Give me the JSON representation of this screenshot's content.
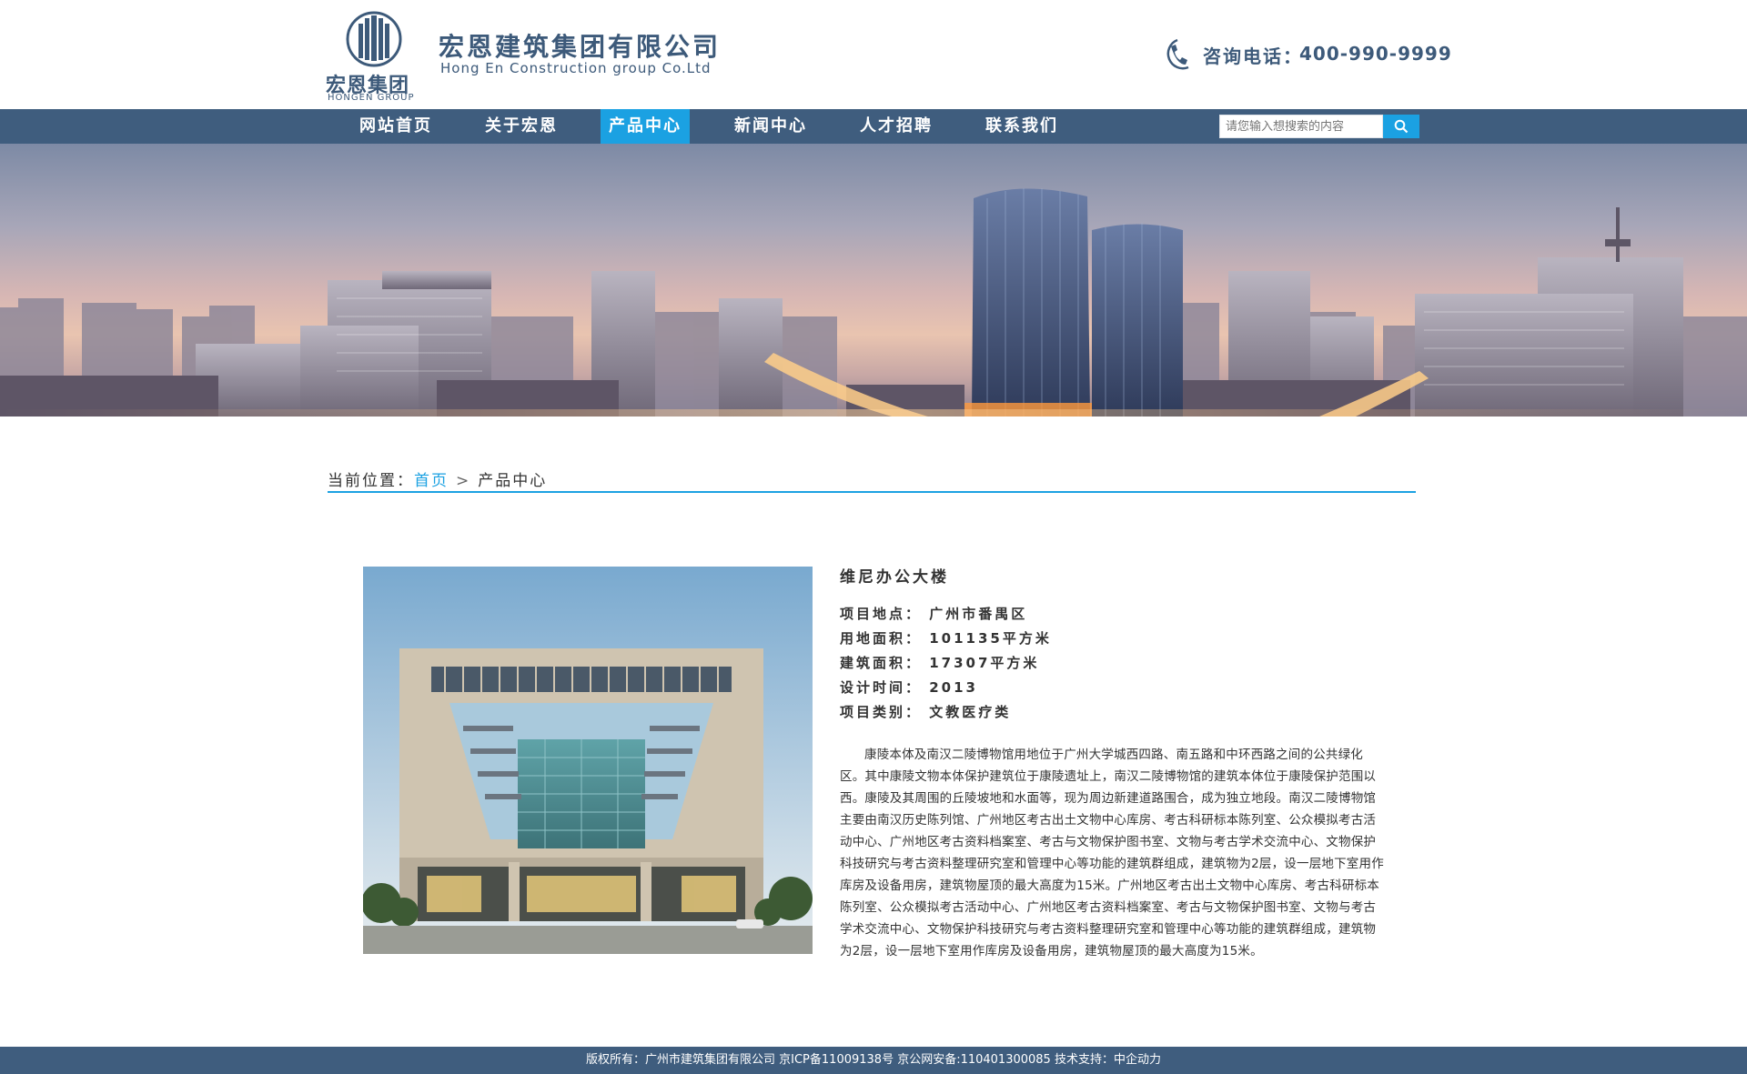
{
  "header": {
    "logo_cn": "宏恩集团",
    "logo_en": "HONGEN GROUP",
    "company_cn": "宏恩建筑集团有限公司",
    "company_en": "Hong En Construction group Co.Ltd",
    "phone_label": "咨询电话：",
    "phone_number": "400-990-9999",
    "brand_color": "#3d5a7a"
  },
  "nav": {
    "items": [
      {
        "label": "网站首页"
      },
      {
        "label": "关于宏恩"
      },
      {
        "label": "产品中心",
        "active": true
      },
      {
        "label": "新闻中心"
      },
      {
        "label": "人才招聘"
      },
      {
        "label": "联系我们"
      }
    ],
    "search_placeholder": "请您输入想搜索的内容",
    "search_icon": "search-icon",
    "nav_color": "#3f5d7e",
    "accent_color": "#1ba1e2"
  },
  "breadcrumb": {
    "prefix": "当前位置：",
    "home": "首页",
    "separator": ">",
    "current": "产品中心"
  },
  "product": {
    "title": "维尼办公大楼",
    "attributes": [
      {
        "text": "项目地点： 广州市番禺区"
      },
      {
        "text": "用地面积： 101135平方米"
      },
      {
        "text": "建筑面积： 17307平方米"
      },
      {
        "text": "设计时间： 2013"
      },
      {
        "text": "项目类别： 文教医疗类"
      }
    ],
    "description": "康陵本体及南汉二陵博物馆用地位于广州大学城西四路、南五路和中环西路之间的公共绿化区。其中康陵文物本体保护建筑位于康陵遗址上，南汉二陵博物馆的建筑本体位于康陵保护范围以西。康陵及其周围的丘陵坡地和水面等，现为周边新建道路围合，成为独立地段。南汉二陵博物馆主要由南汉历史陈列馆、广州地区考古出土文物中心库房、考古科研标本陈列室、公众模拟考古活动中心、广州地区考古资料档案室、考古与文物保护图书室、文物与考古学术交流中心、文物保护科技研究与考古资料整理研究室和管理中心等功能的建筑群组成，建筑物为2层，设一层地下室用作库房及设备用房，建筑物屋顶的最大高度为15米。广州地区考古出土文物中心库房、考古科研标本陈列室、公众模拟考古活动中心、广州地区考古资料档案室、考古与文物保护图书室、文物与考古学术交流中心、文物保护科技研究与考古资料整理研究室和管理中心等功能的建筑群组成，建筑物为2层，设一层地下室用作库房及设备用房，建筑物屋顶的最大高度为15米。"
  },
  "footer": {
    "text": "版权所有：广州市建筑集团有限公司  京ICP备11009138号  京公网安备:110401300085  技术支持：中企动力"
  }
}
